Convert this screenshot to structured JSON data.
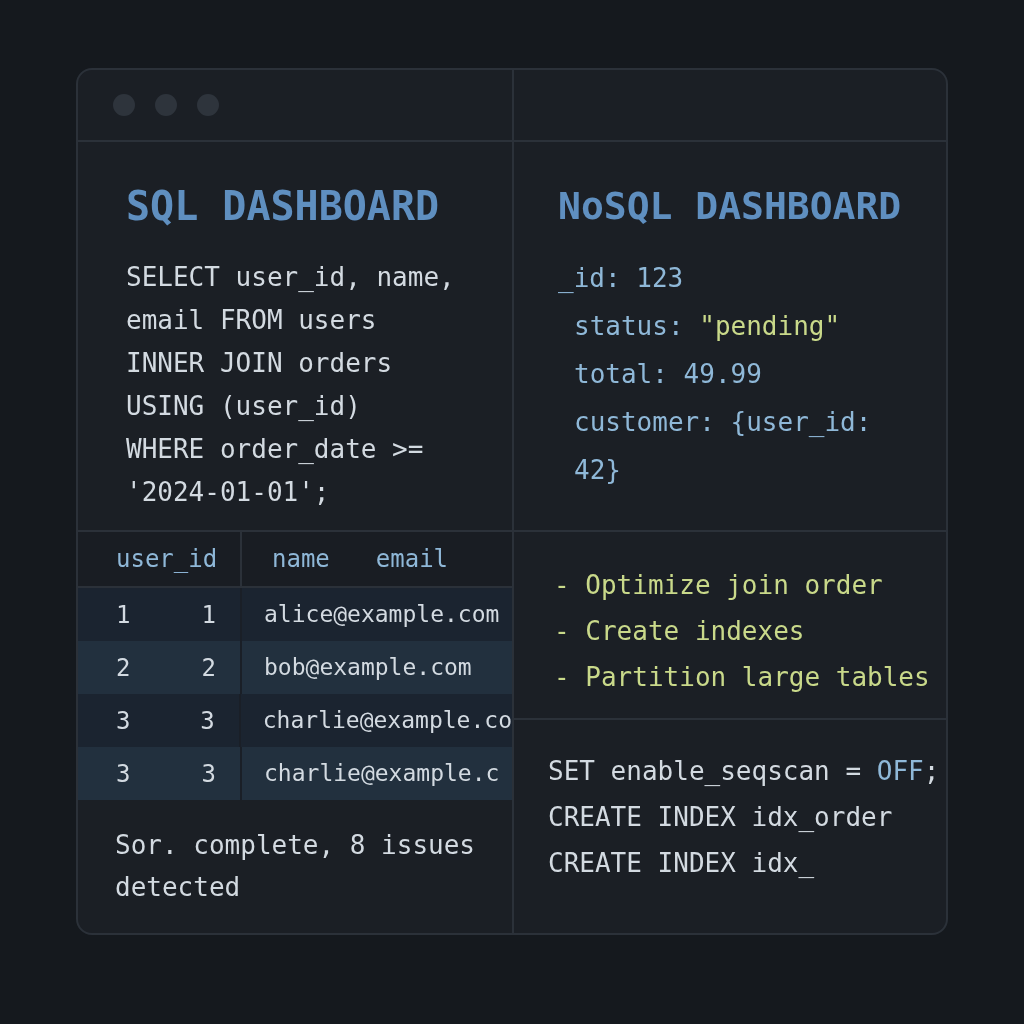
{
  "sql_panel": {
    "title": "SQL DASHBOARD",
    "query_lines": [
      "SELECT user_id, name,",
      "email FROM users",
      "INNER JOIN orders",
      "USING (user_id)",
      "WHERE order_date >=",
      "'2024-01-01';"
    ]
  },
  "nosql_panel": {
    "title": "NoSQL DASHBOARD",
    "lines": [
      [
        {
          "text": "_id: 123",
          "kind": "key"
        }
      ],
      [
        {
          "text": "status: ",
          "kind": "key"
        },
        {
          "text": "\"pending\"",
          "kind": "string"
        }
      ],
      [
        {
          "text": "total: 49.99",
          "kind": "key"
        }
      ],
      [
        {
          "text": "customer: {user_id: 42}",
          "kind": "key"
        }
      ]
    ]
  },
  "table": {
    "header_labels": [
      "user_id",
      "name",
      "email"
    ],
    "records": [
      {
        "numbers": [
          "1",
          "1"
        ],
        "email": "alice@example.com"
      },
      {
        "numbers": [
          "2",
          "2"
        ],
        "email": "bob@example.com"
      },
      {
        "numbers": [
          "3",
          "3"
        ],
        "email": "charlie@example.co"
      },
      {
        "numbers": [
          "3",
          "3"
        ],
        "email": "charlie@example.c"
      }
    ]
  },
  "status": "Sor. complete, 8 issues detected",
  "suggestions": [
    "- Optimize join order",
    "- Create indexes",
    "- Partition large tables"
  ],
  "fix_script": [
    [
      {
        "text": "SET enable_seqscan = ",
        "kind": "plain"
      },
      {
        "text": "OFF",
        "kind": "constant"
      },
      {
        "text": ";",
        "kind": "plain"
      }
    ],
    [
      {
        "text": "CREATE INDEX idx_order",
        "kind": "plain"
      }
    ],
    [
      {
        "text": "CREATE INDEX idx_",
        "kind": "plain"
      }
    ]
  ]
}
